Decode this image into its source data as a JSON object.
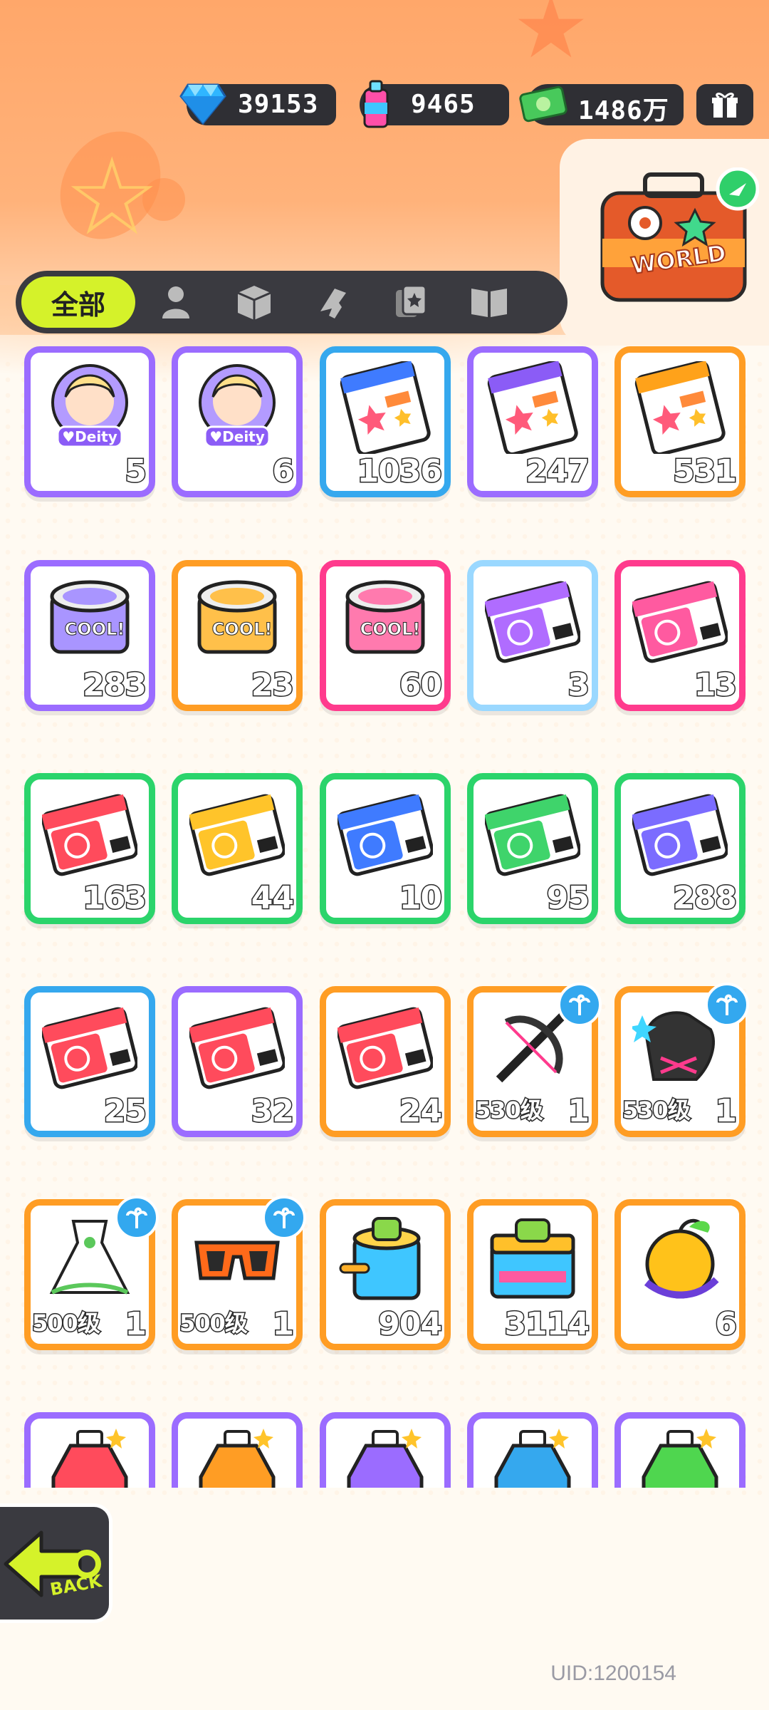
{
  "colors": {
    "active_tab": "#d5f22a",
    "bar": "#2f2f34",
    "purple": "#9b6cff",
    "orange": "#ff9d24",
    "blue": "#35a8ee",
    "green": "#2bd46b",
    "pink": "#ff3b8d"
  },
  "currencies": [
    {
      "icon": "diamond-icon",
      "value": "39153"
    },
    {
      "icon": "spray-can-icon",
      "value": "9465"
    },
    {
      "icon": "cash-icon",
      "value": "1486万"
    }
  ],
  "world_button": {
    "label": "WORLD"
  },
  "tabs": {
    "active_label": "全部",
    "icons": [
      "person-icon",
      "box-icon",
      "gun-icon",
      "card-icon",
      "book-icon"
    ]
  },
  "items": [
    {
      "icon": "deity-avatar-icon",
      "count": "5",
      "color": "#9b6cff"
    },
    {
      "icon": "deity-avatar-girl-icon",
      "count": "6",
      "color": "#9b6cff"
    },
    {
      "icon": "sticker-pack-blue-icon",
      "count": "1036",
      "color": "#35a8ee"
    },
    {
      "icon": "sticker-pack-purple-icon",
      "count": "247",
      "color": "#9b6cff"
    },
    {
      "icon": "sticker-pack-orange-icon",
      "count": "531",
      "color": "#ff9d24"
    },
    {
      "icon": "can-purple-icon",
      "count": "283",
      "color": "#9b6cff"
    },
    {
      "icon": "can-orange-icon",
      "count": "23",
      "color": "#ff9d24"
    },
    {
      "icon": "can-pink-icon",
      "count": "60",
      "color": "#ff3b8d"
    },
    {
      "icon": "ticket-rainbow-icon",
      "count": "3",
      "color": "#9ad8ff"
    },
    {
      "icon": "ticket-pink-icon",
      "count": "13",
      "color": "#ff3b8d"
    },
    {
      "icon": "ticket-red-icon",
      "count": "163",
      "color": "#2bd46b"
    },
    {
      "icon": "ticket-yellow-icon",
      "count": "44",
      "color": "#2bd46b"
    },
    {
      "icon": "ticket-blue-icon",
      "count": "10",
      "color": "#2bd46b"
    },
    {
      "icon": "ticket-green-icon",
      "count": "95",
      "color": "#2bd46b"
    },
    {
      "icon": "ticket-purple-icon",
      "count": "288",
      "color": "#2bd46b"
    },
    {
      "icon": "ticket-red-blue-icon",
      "count": "25",
      "color": "#35a8ee"
    },
    {
      "icon": "ticket-red-purple-icon",
      "count": "32",
      "color": "#9b6cff"
    },
    {
      "icon": "ticket-red-orange-icon",
      "count": "24",
      "color": "#ff9d24"
    },
    {
      "icon": "crossbow-icon",
      "level": "530级",
      "count": "1",
      "color": "#ff9d24",
      "badge": true
    },
    {
      "icon": "glove-icon",
      "level": "530级",
      "count": "1",
      "color": "#ff9d24",
      "badge": true
    },
    {
      "icon": "dress-icon",
      "level": "500级",
      "count": "1",
      "color": "#ff9d24",
      "badge": true
    },
    {
      "icon": "sunglasses-icon",
      "level": "500级",
      "count": "1",
      "color": "#ff9d24",
      "badge": true
    },
    {
      "icon": "paint-bucket-icon",
      "count": "904",
      "color": "#ff9d24"
    },
    {
      "icon": "paint-box-icon",
      "count": "3114",
      "color": "#ff9d24"
    },
    {
      "icon": "golden-apple-icon",
      "count": "6",
      "color": "#ff9d24"
    },
    {
      "icon": "star-bottle-red-icon",
      "count": "",
      "color": "#9b6cff"
    },
    {
      "icon": "star-bottle-orange-icon",
      "count": "",
      "color": "#9b6cff"
    },
    {
      "icon": "star-bottle-purple-icon",
      "count": "",
      "color": "#9b6cff"
    },
    {
      "icon": "star-bottle-blue-icon",
      "count": "",
      "color": "#9b6cff"
    },
    {
      "icon": "star-bottle-green-icon",
      "count": "",
      "color": "#9b6cff"
    }
  ],
  "back_button": {
    "label": "BACK"
  },
  "uid": "UID:1200154"
}
